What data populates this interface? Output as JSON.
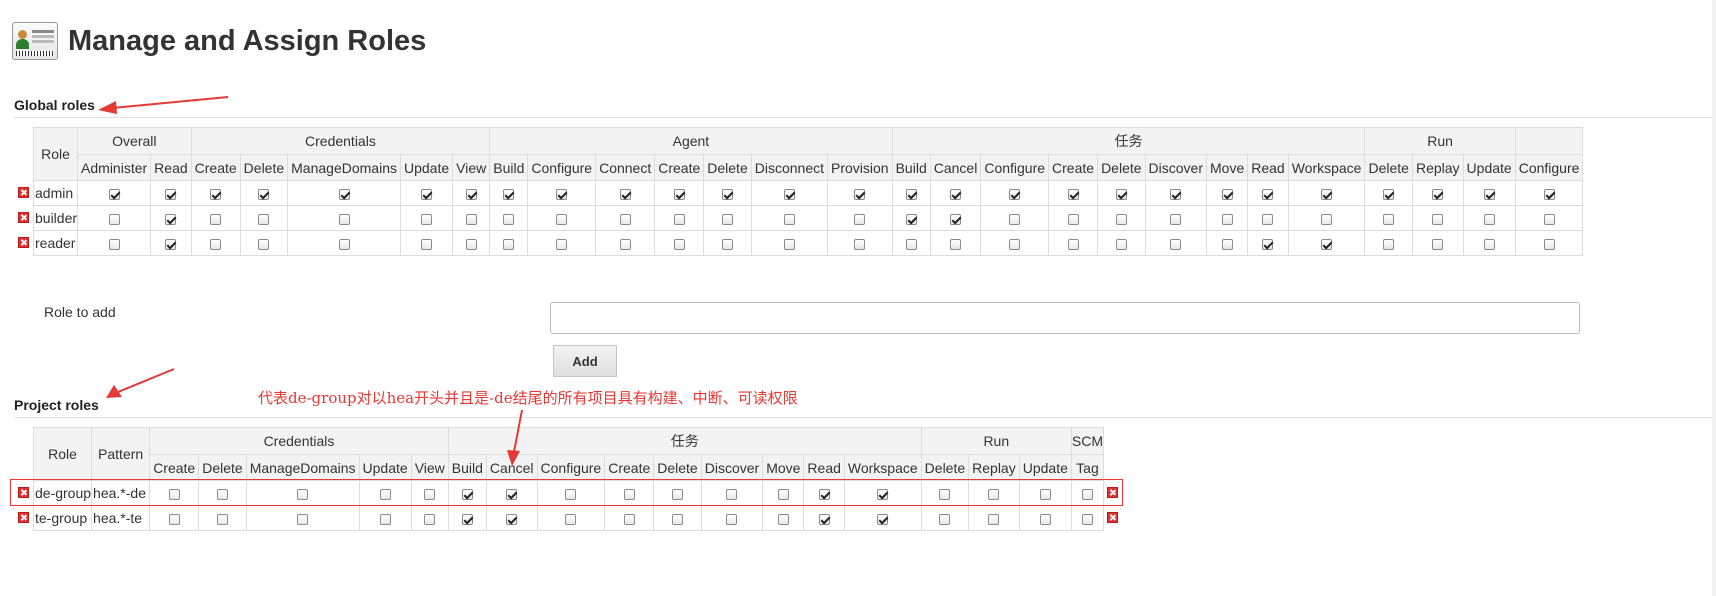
{
  "page": {
    "title": "Manage and Assign Roles"
  },
  "global_roles": {
    "title": "Global roles",
    "role_header": "Role",
    "groups": [
      {
        "label": "Overall",
        "span": 2
      },
      {
        "label": "Credentials",
        "span": 5
      },
      {
        "label": "Agent",
        "span": 7
      },
      {
        "label": "任务",
        "span": 9
      },
      {
        "label": "Run",
        "span": 3
      },
      {
        "label": "",
        "span": 1
      }
    ],
    "columns": [
      "Administer",
      "Read",
      "Create",
      "Delete",
      "ManageDomains",
      "Update",
      "View",
      "Build",
      "Configure",
      "Connect",
      "Create",
      "Delete",
      "Disconnect",
      "Provision",
      "Build",
      "Cancel",
      "Configure",
      "Create",
      "Delete",
      "Discover",
      "Move",
      "Read",
      "Workspace",
      "Delete",
      "Replay",
      "Update",
      "Configure"
    ],
    "rows": [
      {
        "name": "admin",
        "perms": [
          1,
          1,
          1,
          1,
          1,
          1,
          1,
          1,
          1,
          1,
          1,
          1,
          1,
          1,
          1,
          1,
          1,
          1,
          1,
          1,
          1,
          1,
          1,
          1,
          1,
          1,
          1
        ]
      },
      {
        "name": "builder",
        "perms": [
          0,
          1,
          0,
          0,
          0,
          0,
          0,
          0,
          0,
          0,
          0,
          0,
          0,
          0,
          1,
          1,
          0,
          0,
          0,
          0,
          0,
          0,
          0,
          0,
          0,
          0,
          0
        ]
      },
      {
        "name": "reader",
        "perms": [
          0,
          1,
          0,
          0,
          0,
          0,
          0,
          0,
          0,
          0,
          0,
          0,
          0,
          0,
          0,
          0,
          0,
          0,
          0,
          0,
          0,
          1,
          1,
          0,
          0,
          0,
          0
        ]
      }
    ]
  },
  "role_to_add": {
    "label": "Role to add",
    "value": "",
    "button": "Add"
  },
  "project_roles": {
    "title": "Project roles",
    "role_header": "Role",
    "pattern_header": "Pattern",
    "groups": [
      {
        "label": "Credentials",
        "span": 5
      },
      {
        "label": "任务",
        "span": 9
      },
      {
        "label": "Run",
        "span": 3
      },
      {
        "label": "SCM",
        "span": 1
      }
    ],
    "columns": [
      "Create",
      "Delete",
      "ManageDomains",
      "Update",
      "View",
      "Build",
      "Cancel",
      "Configure",
      "Create",
      "Delete",
      "Discover",
      "Move",
      "Read",
      "Workspace",
      "Delete",
      "Replay",
      "Update",
      "Tag"
    ],
    "rows": [
      {
        "name": "de-group",
        "pattern": "hea.*-de",
        "perms": [
          0,
          0,
          0,
          0,
          0,
          1,
          1,
          0,
          0,
          0,
          0,
          0,
          1,
          1,
          0,
          0,
          0,
          0
        ]
      },
      {
        "name": "te-group",
        "pattern": "hea.*-te",
        "perms": [
          0,
          0,
          0,
          0,
          0,
          1,
          1,
          0,
          0,
          0,
          0,
          0,
          1,
          1,
          0,
          0,
          0,
          0
        ]
      }
    ]
  },
  "annotation": {
    "text": "代表de-group对以hea开头并且是-de结尾的所有项目具有构建、中断、可读权限",
    "color": "#e53935"
  }
}
